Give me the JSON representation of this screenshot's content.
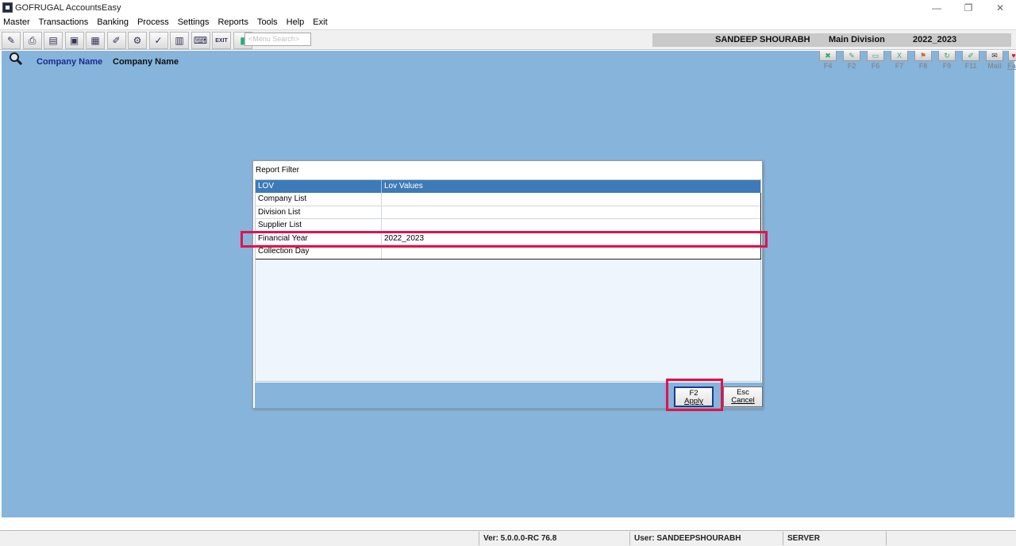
{
  "window": {
    "title": "GOFRUGAL AccountsEasy",
    "controls": [
      "—",
      "❐",
      "✕"
    ]
  },
  "menu": {
    "items": [
      "Master",
      "Transactions",
      "Banking",
      "Process",
      "Settings",
      "Reports",
      "Tools",
      "Help",
      "Exit"
    ]
  },
  "toolbar": {
    "icons": [
      "pencil-icon",
      "print-icon",
      "book-icon",
      "id-card-icon",
      "box-icon",
      "edit-icon",
      "gear-doc-icon",
      "chart-edit-icon",
      "grid-icon",
      "keyboard-icon",
      "exit-icon",
      "bar-chart-icon"
    ],
    "exit_label": "EXIT",
    "search_placeholder": "<Menu Search>"
  },
  "session": {
    "user": "SANDEEP SHOURABH",
    "division": "Main Division",
    "financial_year": "2022_2023"
  },
  "header": {
    "company_label": "Company Name",
    "company_value": "Company Name"
  },
  "function_keys": [
    "F4",
    "F2",
    "F6",
    "F7",
    "F8",
    "F9",
    "F11",
    "Mail",
    "Fav"
  ],
  "dialog": {
    "title": "Report Filter",
    "columns": [
      "LOV",
      "Lov Values"
    ],
    "rows": [
      {
        "lov": "Company List",
        "value": ""
      },
      {
        "lov": "Division List",
        "value": ""
      },
      {
        "lov": "Supplier List",
        "value": ""
      },
      {
        "lov": "Financial Year",
        "value": "2022_2023"
      },
      {
        "lov": "Collection Day",
        "value": ""
      }
    ],
    "apply": {
      "key": "F2",
      "label": "Apply"
    },
    "cancel": {
      "key": "Esc",
      "label": "Cancel"
    }
  },
  "status": {
    "version": "Ver: 5.0.0.0-RC 76.8",
    "user": "User: SANDEEPSHOURABH",
    "server": "SERVER"
  },
  "colors": {
    "main_bg": "#86b4db",
    "grid_header": "#3d7ab8",
    "highlight": "#e0134e"
  }
}
